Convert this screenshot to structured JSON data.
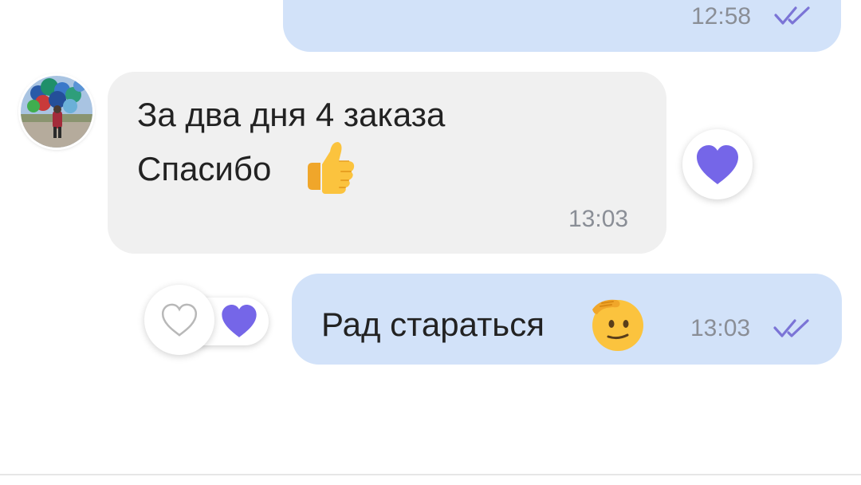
{
  "messages": [
    {
      "direction": "outgoing",
      "time": "12:58",
      "read_status": "double-check-icon"
    },
    {
      "direction": "incoming",
      "line1": "За два дня 4 заказа",
      "line2": "Спасибо",
      "emoji": "👍",
      "time": "13:03",
      "reaction": "heart-icon",
      "reaction_color": "#7566e8"
    },
    {
      "direction": "outgoing",
      "text": "Рад стараться",
      "emoji": "🫡",
      "time": "13:03",
      "read_status": "double-check-icon",
      "like_icon": "heart-outline-icon",
      "reaction": "heart-icon",
      "reaction_color": "#7566e8"
    }
  ],
  "colors": {
    "outgoing_bubble": "#d2e2f9",
    "incoming_bubble": "#f0f0f0",
    "accent": "#7566e8",
    "timestamp": "#8a8e96"
  }
}
